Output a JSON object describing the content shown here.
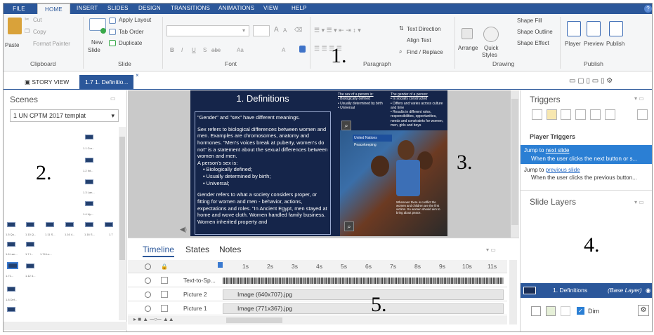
{
  "menu": {
    "tabs": [
      "FILE",
      "HOME",
      "INSERT",
      "SLIDES",
      "DESIGN",
      "TRANSITIONS",
      "ANIMATIONS",
      "VIEW",
      "HELP"
    ],
    "active": "HOME",
    "help_glyph": "?"
  },
  "ribbon": {
    "clipboard": {
      "paste": "Paste",
      "cut": "Cut",
      "copy": "Copy",
      "format_painter": "Format Painter",
      "label": "Clipboard"
    },
    "slide": {
      "new_slide": "New",
      "new_slide2": "Slide",
      "apply_layout": "Apply Layout",
      "tab_order": "Tab Order",
      "duplicate": "Duplicate",
      "label": "Slide"
    },
    "font": {
      "label": "Font",
      "bold": "B",
      "italic": "I",
      "underline": "U",
      "strike": "S",
      "abc": "abc",
      "aa": "Aa",
      "a_up": "A",
      "a_down": "A",
      "a_color": "A"
    },
    "paragraph": {
      "text_direction": "Text Direction",
      "align_text": "Align Text",
      "find_replace": "Find / Replace",
      "label": "Paragraph"
    },
    "drawing": {
      "arrange": "Arrange",
      "quick_styles": "Quick",
      "quick_styles2": "Styles",
      "shape_fill": "Shape Fill",
      "shape_outline": "Shape Outline",
      "shape_effect": "Shape Effect",
      "label": "Drawing"
    },
    "publish": {
      "player": "Player",
      "preview": "Preview",
      "publish": "Publish",
      "label": "Publish"
    }
  },
  "doc_tabs": {
    "story_view": "STORY VIEW",
    "current": "1.7 1. Definitio...",
    "close_glyph": "×"
  },
  "scenes": {
    "title": "Scenes",
    "selected": "1 UN CPTM 2017 templat",
    "thumb_labels": [
      "1.1 Cor...",
      "1.2 Int...",
      "1.3 Lan...",
      "1.4 Up...",
      "1.5 Qu...",
      "1.10 Q...",
      "1.11 S...",
      "1.16 4...",
      "1.16 S...",
      "1.7",
      "1.6 Lan...",
      "1.7 I...",
      "1.74 Lo...",
      "1.71...",
      "1.12 4...",
      "1.8 Def..."
    ]
  },
  "slide": {
    "title": "1. Definitions",
    "paragraphs": [
      "\"Gender\" and \"sex\" have different meanings.",
      "Sex refers to biological differences between women and men. Examples are chromosomes, anatomy and hormones. \"Men's voices break at puberty, women's do not\" is a statement about the sexual differences between women and men.",
      "A person's sex is:",
      "Gender refers to what a society considers proper, or fitting for women and men - behavior, actions, expectations and roles. \"In Ancient Egypt, men stayed at home and wove cloth. Women handled family business. Women inherited property and"
    ],
    "bullets": [
      "Biologically defined;",
      "Usually determined by birth;",
      "Universal;"
    ],
    "sex_heading": "The sex of a person is:",
    "sex_items": [
      "Biologically defined",
      "Usually determined by birth",
      "Universal"
    ],
    "gender_heading": "The gender of a person:",
    "gender_items": [
      "Is socially constructed",
      "Differs and varies across culture and time",
      "Results in different roles, responsibilities, opportunities, needs and constraints for women, men, girls and boys"
    ],
    "photo_caption": "Whenever there is conflict the women and children are the first victims. So women should aim to bring about peace.",
    "un_logo": "United Nations Peacekeeping"
  },
  "timeline": {
    "tabs": [
      "Timeline",
      "States",
      "Notes"
    ],
    "ticks": [
      "1s",
      "2s",
      "3s",
      "4s",
      "5s",
      "6s",
      "7s",
      "8s",
      "9s",
      "10s",
      "11s"
    ],
    "tracks": [
      {
        "name": "Text-to-Sp...",
        "bar": ""
      },
      {
        "name": "Picture 2",
        "bar": "Image (640x707).jpg"
      },
      {
        "name": "Picture 1",
        "bar": "Image (771x367).jpg"
      }
    ]
  },
  "triggers": {
    "title": "Triggers",
    "player_triggers": "Player Triggers",
    "t1_prefix": "Jump to ",
    "t1_link": "next slide",
    "t1_when": "When the user clicks the next button or s...",
    "t2_prefix": "Jump to ",
    "t2_link": "previous slide",
    "t2_when": "When the user clicks the previous button...",
    "slide_layers": "Slide Layers",
    "base_layer": "1. Definitions",
    "base_layer_tag": "(Base Layer)",
    "dim": "Dim"
  },
  "annotations": [
    "1.",
    "2.",
    "3.",
    "4.",
    "5."
  ],
  "colors": {
    "accent": "#2b579a",
    "selection": "#2b7fd4",
    "slide_bg": "#15254a"
  }
}
